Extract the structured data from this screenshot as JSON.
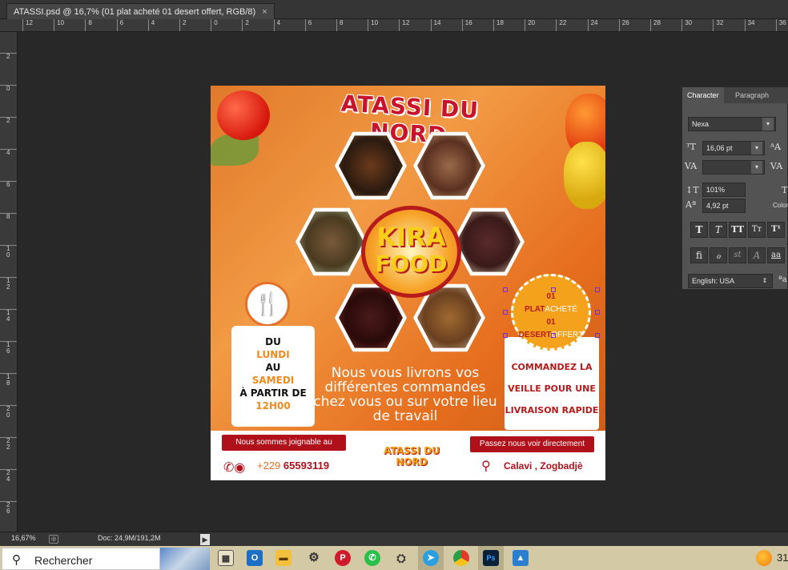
{
  "document_tab": {
    "title": "ATASSI.psd @ 16,7% (01 plat acheté 01 desert offert, RGB/8)",
    "close_glyph": "×"
  },
  "ruler_top": [
    "12",
    "10",
    "8",
    "6",
    "4",
    "2",
    "0",
    "2",
    "4",
    "6",
    "8",
    "10",
    "12",
    "14",
    "16",
    "18",
    "20",
    "22",
    "24",
    "26",
    "28",
    "30",
    "32",
    "34",
    "36"
  ],
  "ruler_left": [
    "2",
    "0",
    "2",
    "4",
    "6",
    "8",
    "1\n0",
    "1\n2",
    "1\n4",
    "1\n6",
    "1\n8",
    "2\n0",
    "2\n2",
    "2\n4",
    "2\n6"
  ],
  "artwork": {
    "brand_title": "ATASSI DU NORD",
    "badge_line1": "KIRA",
    "badge_line2": "FOOD",
    "days": {
      "line1": "DU",
      "line2": "LUNDI",
      "line3": "AU",
      "line4": "SAMEDI",
      "line5": "À PARTIR DE",
      "line6": "12H00"
    },
    "promo": "Nous vous livrons vos différentes commandes chez vous ou sur votre lieu de travail",
    "offer": {
      "count1": "01",
      "label1a": "PLAT",
      "label1b": "ACHETÉ",
      "count2": "01",
      "label2a": "DESERT",
      "label2b": "OFFERT"
    },
    "order_card": {
      "line1": "COMMANDEZ LA",
      "line2": "VEILLE  POUR UNE",
      "line3": "LIVRAISON RAPIDE"
    },
    "contact_pill": "Nous sommes joignable au",
    "phone_prefix": "+229",
    "phone_number": "65593119",
    "small_logo": "ATASSI DU NORD",
    "visit_pill": "Passez nous voir directement",
    "location": "Calavi , Zogbadjè"
  },
  "character_panel": {
    "tab_character": "Character",
    "tab_paragraph": "Paragraph",
    "font_family": "Nexa",
    "font_size": "16,06 pt",
    "tracking": "",
    "vertical_scale": "101%",
    "baseline_shift": "4,92 pt",
    "color_label": "Color",
    "language": "English: USA",
    "style_buttons": [
      "T",
      "T",
      "TT",
      "Tт",
      "T¹"
    ],
    "opentype_buttons": [
      "ﬁ",
      "ℴ",
      "st",
      "A",
      "aa"
    ],
    "aa_glyph": "a"
  },
  "statusbar": {
    "zoom": "16,67%",
    "doc_info": "Doc: 24,9M/191,2M"
  },
  "taskbar": {
    "search_label": "Rechercher",
    "tray_text": "31"
  },
  "colors": {
    "accent_red": "#b0101a",
    "accent_orange": "#f08a1e",
    "ps_dark": "#282828"
  },
  "icons": [
    "search-icon",
    "task-view-icon",
    "outlook-icon",
    "file-explorer-icon",
    "settings-icon",
    "pinterest-icon",
    "whatsapp-icon",
    "steam-icon",
    "telegram-icon",
    "chrome-icon",
    "photoshop-icon",
    "photos-icon"
  ]
}
